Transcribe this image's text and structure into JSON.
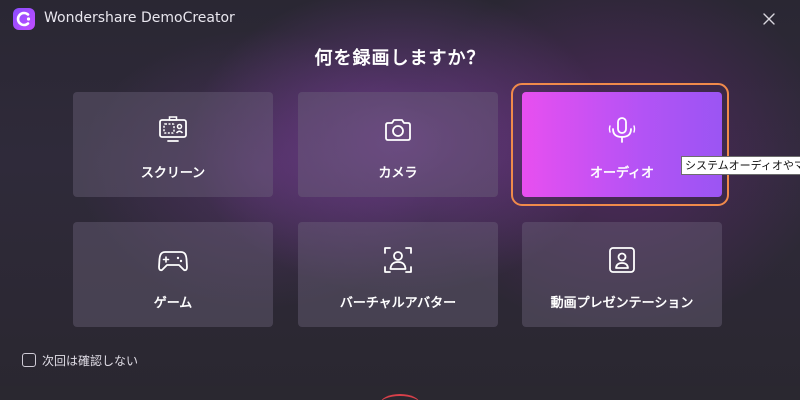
{
  "window": {
    "app_title": "Wondershare DemoCreator",
    "logo_icon": "democreator-logo-icon",
    "close_icon": "close-icon"
  },
  "main": {
    "heading": "何を録画しますか？",
    "cards": [
      {
        "id": "screen",
        "label": "スクリーン",
        "icon": "screen-record-icon"
      },
      {
        "id": "camera",
        "label": "カメラ",
        "icon": "camera-icon"
      },
      {
        "id": "audio",
        "label": "オーディオ",
        "icon": "microphone-icon",
        "selected": true
      },
      {
        "id": "game",
        "label": "ゲーム",
        "icon": "gamepad-icon"
      },
      {
        "id": "avatar",
        "label": "バーチャルアバター",
        "icon": "avatar-icon"
      },
      {
        "id": "video",
        "label": "動画プレゼンテーション",
        "icon": "presentation-icon"
      }
    ],
    "tooltip": "システムオーディオやマイク"
  },
  "footer": {
    "dont_ask_label": "次回は確認しない",
    "dont_ask_checked": false
  },
  "colors": {
    "accent_gradient_start": "#e84ff0",
    "accent_gradient_end": "#9b55f3",
    "selection_ring": "#f08a4b",
    "card_bg": "#5a5266",
    "record_accent": "#d8404a"
  }
}
